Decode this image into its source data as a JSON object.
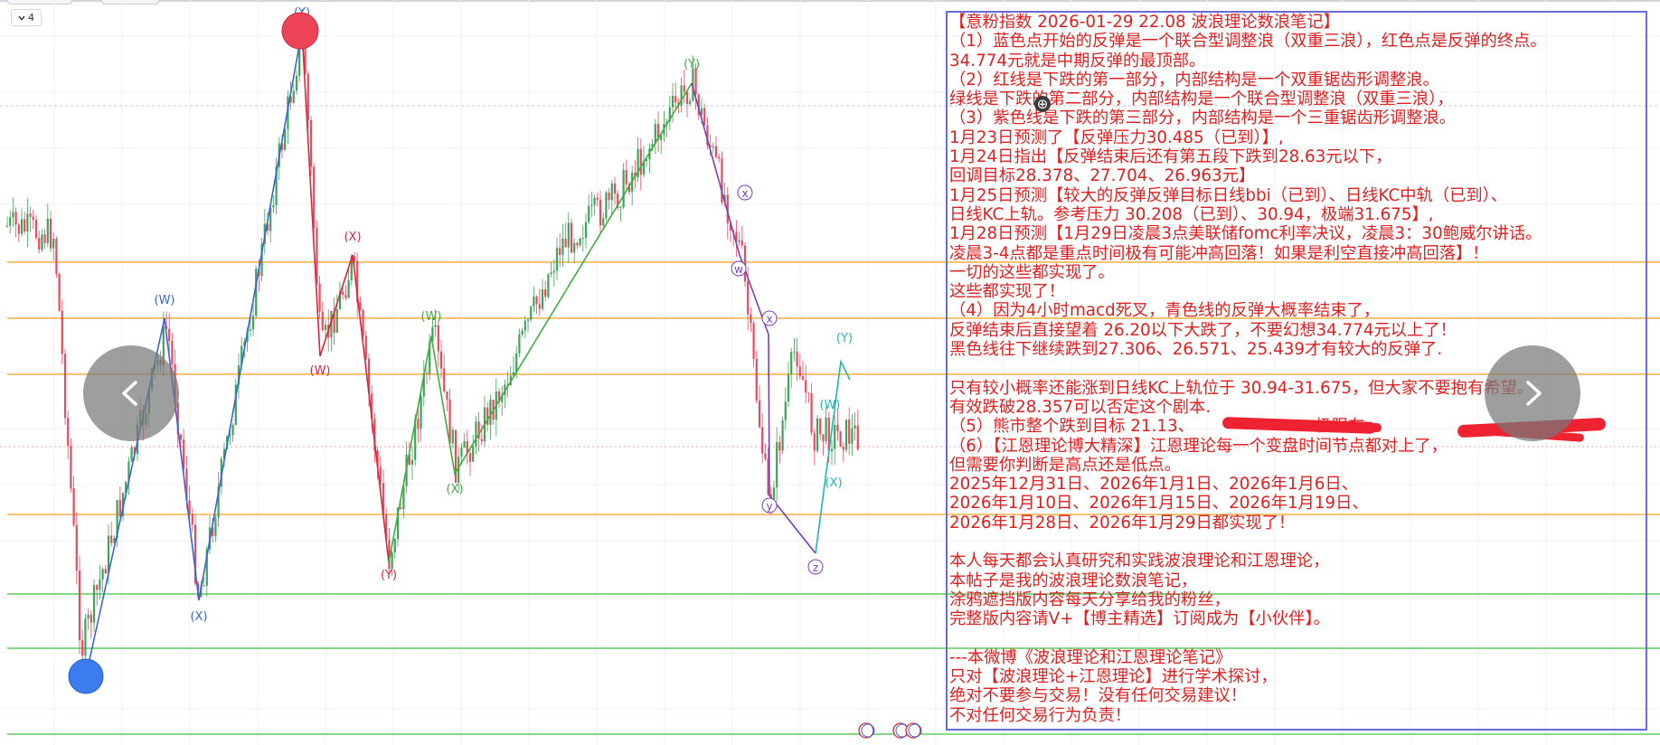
{
  "toolbar": {
    "interval_label": "4",
    "interval_icon": "chevron-down-icon"
  },
  "colors": {
    "up_candle": "#3fa35a",
    "down_candle": "#e84a5f",
    "blue_wave": "#3a63d8",
    "red_wave": "#d8263d",
    "green_wave": "#3fae3f",
    "purple_wave": "#7a3fb8",
    "cyan_wave": "#1fb5b5",
    "level_orange": "#f0a020",
    "level_green": "#3cbf3c",
    "note_text": "#e02020",
    "note_border": "#6b6bd8"
  },
  "chart_data": {
    "type": "candlestick",
    "description_series": "wave labels drawn on chart",
    "wave_labels": [
      {
        "text": "(Y)",
        "color": "blue"
      },
      {
        "text": "(W)",
        "color": "blue"
      },
      {
        "text": "(X)",
        "color": "blue"
      },
      {
        "text": "(X)",
        "color": "red"
      },
      {
        "text": "(W)",
        "color": "red"
      },
      {
        "text": "(Y)",
        "color": "red"
      },
      {
        "text": "(W)",
        "color": "green"
      },
      {
        "text": "(X)",
        "color": "green"
      },
      {
        "text": "(Y)",
        "color": "green"
      },
      {
        "text": "x",
        "color": "purple"
      },
      {
        "text": "w",
        "color": "purple"
      },
      {
        "text": "x",
        "color": "purple"
      },
      {
        "text": "y",
        "color": "purple"
      },
      {
        "text": "z",
        "color": "purple"
      },
      {
        "text": "(Y)",
        "color": "cyan"
      },
      {
        "text": "(W)",
        "color": "cyan"
      },
      {
        "text": "(X)",
        "color": "cyan"
      }
    ],
    "grid": true
  },
  "note": {
    "lines": [
      "【意粉指数 2026-01-29 22.08 波浪理论数浪笔记】",
      "（1）蓝色点开始的反弹是一个联合型调整浪（双重三浪），红色点是反弹的终点。",
      "34.774元就是中期反弹的最顶部。",
      "（2）红线是下跌的第一部分，内部结构是一个双重锯齿形调整浪。",
      "绿线是下跌的第二部分，内部结构是一个联合型调整浪（双重三浪），",
      "（3）紫色线是下跌的第三部分，内部结构是一个三重锯齿形调整浪。",
      "1月23日预测了【反弹压力30.485（已到）】,",
      "1月24日指出【反弹结束后还有第五段下跌到28.63元以下，",
      "回调目标28.378、27.704、26.963元】",
      "1月25日预测【较大的反弹反弹目标日线bbi（已到）、日线KC中轨（已到）、",
      "日线KC上轨。参考压力 30.208（已到）、30.94，极端31.675】,",
      "1月28日预测【1月29日凌晨3点美联储fomc利率决议，凌晨3：30鲍威尔讲话。",
      "凌晨3-4点都是重点时间极有可能冲高回落！如果是利空直接冲高回落】！",
      "一切的这些都实现了。",
      "这些都实现了！",
      "（4）因为4小时macd死叉，青色线的反弹大概率结束了，",
      "反弹结束后直接望着 26.20以下大跌了，不要幻想34.774元以上了！",
      "黑色线往下继续跌到27.306、26.571、25.439才有较大的反弹了.",
      "",
      "只有较小概率还能涨到日线KC上轨位于 30.94-31.675，但大家不要抱有希望。",
      "有效跌破28.357可以否定这个剧本.",
      "（5）熊市整个跌到目标 21.13、                       极限在",
      "（6）【江恩理论博大精深】江恩理论每一个变盘时间节点都对上了，",
      "但需要你判断是高点还是低点。",
      "2025年12月31日、2026年1月1日、2026年1月6日、",
      "2026年1月10日、2026年1月15日、2026年1月19日、",
      "2026年1月28日、2026年1月29日都实现了！",
      "",
      "本人每天都会认真研究和实践波浪理论和江恩理论，",
      "本帖子是我的波浪理论数浪笔记，",
      "涂鸦遮挡版内容每天分享给我的粉丝，",
      "完整版内容请V+【博主精选】订阅成为【小伙伴】。",
      "",
      "---本微博《波浪理论和江恩理论笔记》",
      "只对【波浪理论+江恩理论】进行学术探讨，",
      "绝对不要参与交易！没有任何交易建议！",
      "不对任何交易行为负责！"
    ]
  },
  "nav": {
    "prev_icon": "chevron-left-icon",
    "next_icon": "chevron-right-icon"
  }
}
